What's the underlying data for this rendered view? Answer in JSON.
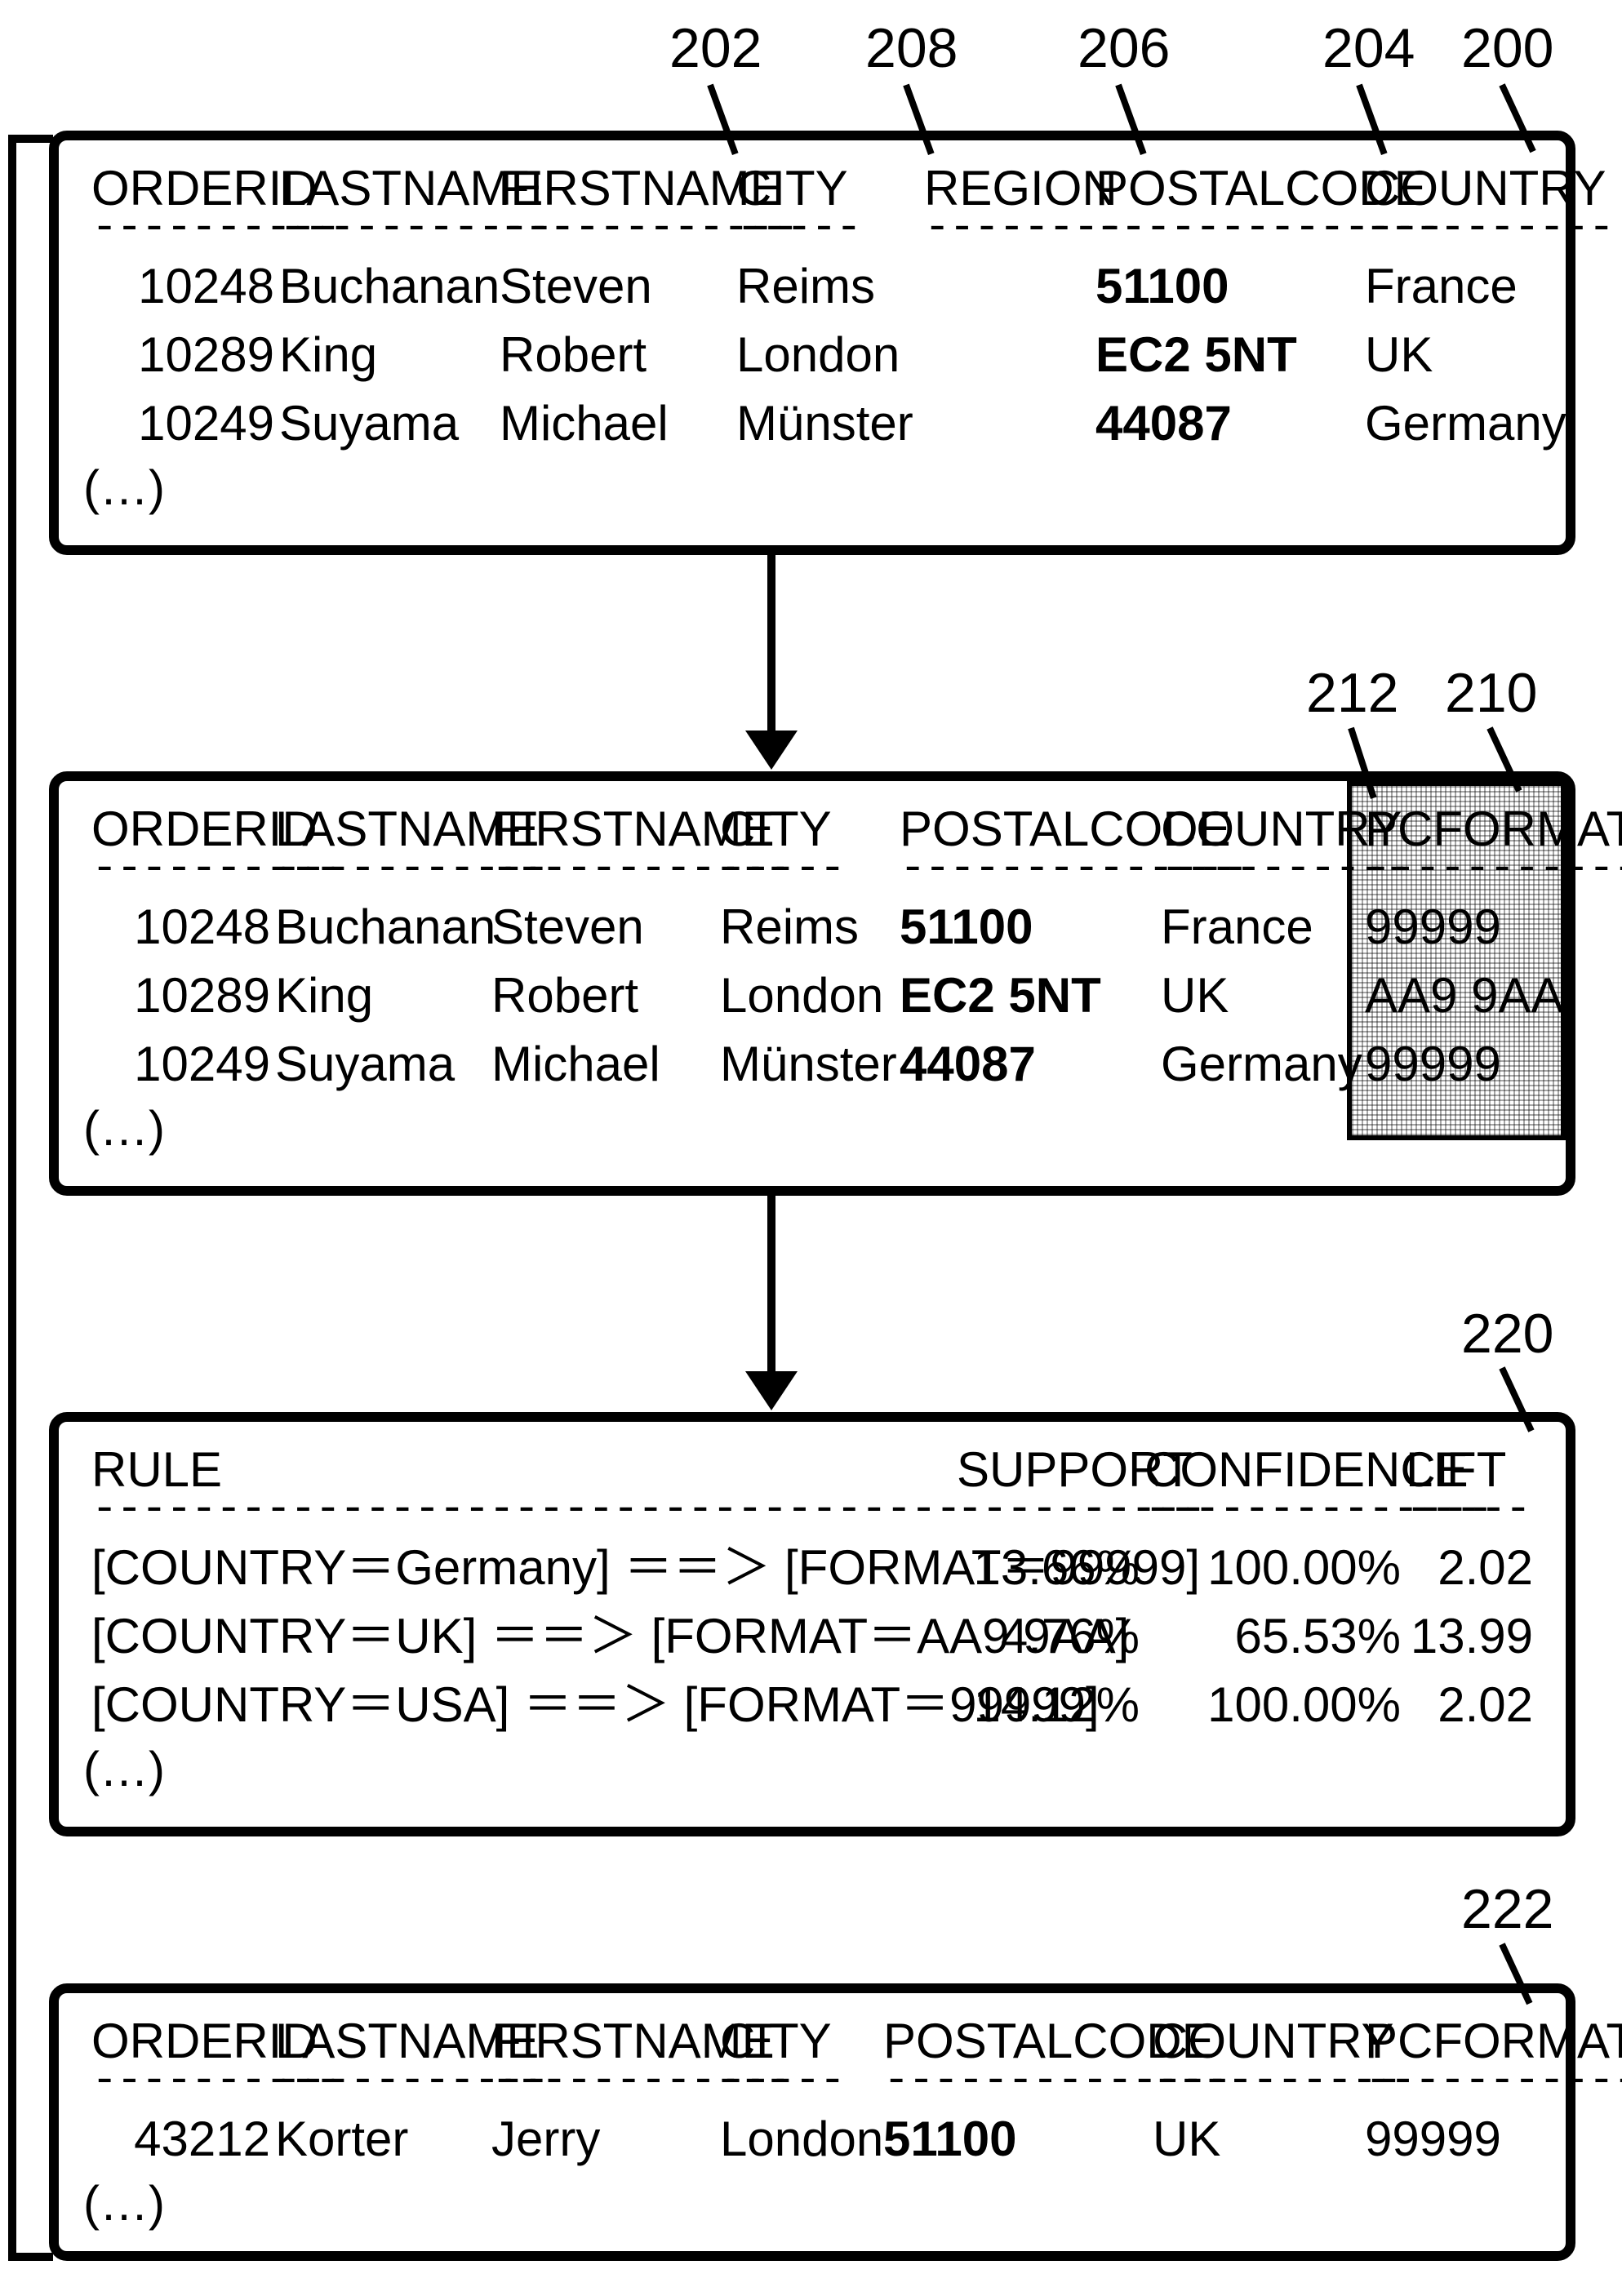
{
  "labels": {
    "l200": "200",
    "l202": "202",
    "l204": "204",
    "l206": "206",
    "l208": "208",
    "l210": "210",
    "l212": "212",
    "l220": "220",
    "l222": "222"
  },
  "more": "(…)",
  "box1": {
    "headers": [
      "ORDERID",
      "LASTNAME",
      "FIRSTNAME",
      "CITY",
      "REGION",
      "POSTALCODE",
      "COUNTRY"
    ],
    "dashes": [
      "----------",
      "-----------",
      "------------",
      "-----",
      "--------",
      "--------------",
      "----------"
    ],
    "rows": [
      [
        "10248",
        "Buchanan",
        "Steven",
        "Reims",
        "",
        "51100",
        "France"
      ],
      [
        "10289",
        "King",
        "Robert",
        "London",
        "",
        "EC2 5NT",
        "UK"
      ],
      [
        "10249",
        "Suyama",
        "Michael",
        "Münster",
        "",
        "44087",
        "Germany"
      ]
    ]
  },
  "box2": {
    "headers": [
      "ORDERID",
      "LASTNAME",
      "FIRSTNAME",
      "CITY",
      "POSTALCODE",
      "COUNTRY",
      "PCFORMAT"
    ],
    "dashes": [
      "----------",
      "-----------",
      "------------",
      "-----",
      "--------------",
      "----------",
      "------------"
    ],
    "rows": [
      [
        "10248",
        "Buchanan",
        "Steven",
        "Reims",
        "51100",
        "France",
        "99999"
      ],
      [
        "10289",
        "King",
        "Robert",
        "London",
        "EC2 5NT",
        "UK",
        "AA9 9AA"
      ],
      [
        "10249",
        "Suyama",
        "Michael",
        "Münster",
        "44087",
        "Germany",
        "99999"
      ]
    ]
  },
  "box3": {
    "headers": [
      "RULE",
      "SUPPORT",
      "CONFIDENCE",
      "LIFT"
    ],
    "dash": "---------------------------------------------------------------------------------------------------",
    "dashes2": [
      "----------",
      "--------------",
      "-----"
    ],
    "rows": [
      [
        "[COUNTRY＝Germany] ＝＝＞ [FORMAT＝99999]",
        "13.66%",
        "100.00%",
        "2.02"
      ],
      [
        "[COUNTRY＝UK] ＝＝＞ [FORMAT＝AA9 9AA]",
        "4.76%",
        "65.53%",
        "13.99"
      ],
      [
        "[COUNTRY＝USA] ＝＝＞ [FORMAT＝99999]",
        "14.12%",
        "100.00%",
        "2.02"
      ]
    ]
  },
  "box4": {
    "headers": [
      "ORDERID",
      "LASTNAME",
      "FIRSTNAME",
      "CITY",
      "POSTALCODE",
      "COUNTRY",
      "PCFORMAT"
    ],
    "dashes": [
      "----------",
      "-----------",
      "------------",
      "-----",
      "--------------",
      "----------",
      "------------"
    ],
    "rows": [
      [
        "43212",
        "Korter",
        "Jerry",
        "London",
        "51100",
        "UK",
        "99999"
      ]
    ]
  }
}
